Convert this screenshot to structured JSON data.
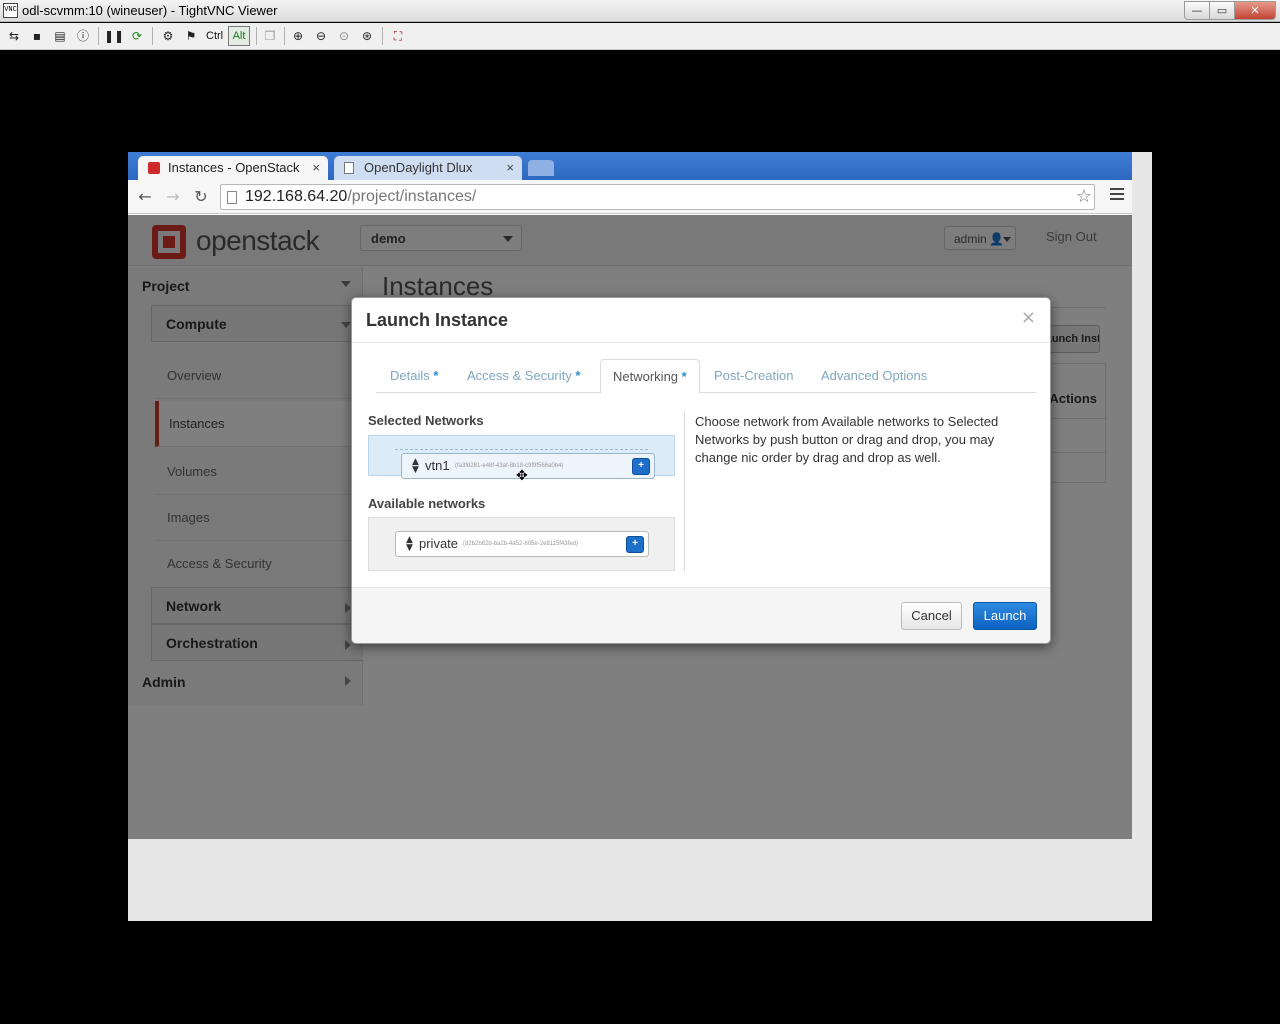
{
  "vnc": {
    "title": "odl-scvmm:10 (wineuser) - TightVNC Viewer",
    "icon_label": "VNC",
    "window_controls": {
      "minimize": "—",
      "maximize": "▭",
      "close": "✕"
    },
    "toolbar": {
      "ctrl_label": "Ctrl",
      "alt_label": "Alt"
    }
  },
  "browser": {
    "tabs": [
      {
        "label": "Instances - OpenStack",
        "close": "×",
        "active": true
      },
      {
        "label": "OpenDaylight Dlux",
        "close": "×",
        "active": false
      }
    ],
    "url_host": "192.168.64.20",
    "url_path": "/project/instances/"
  },
  "dashboard": {
    "brand": "openstack",
    "project_selector": "demo",
    "user_menu": "admin",
    "sign_out": "Sign Out",
    "sidebar": {
      "project": "Project",
      "compute": "Compute",
      "items": [
        "Overview",
        "Instances",
        "Volumes",
        "Images",
        "Access & Security"
      ],
      "network": "Network",
      "orchestration": "Orchestration",
      "admin": "Admin"
    },
    "page_title": "Instances",
    "launch_button": "Launch Instance",
    "actions_header": "Actions"
  },
  "modal": {
    "title": "Launch Instance",
    "close": "×",
    "tabs": [
      {
        "label": "Details",
        "required": "*"
      },
      {
        "label": "Access & Security",
        "required": "*"
      },
      {
        "label": "Networking",
        "required": "*"
      },
      {
        "label": "Post-Creation",
        "required": ""
      },
      {
        "label": "Advanced Options",
        "required": ""
      }
    ],
    "active_tab": "Networking",
    "selected_networks_label": "Selected Networks",
    "available_networks_label": "Available networks",
    "selected_networks": [
      {
        "name": "vtn1",
        "id": "(fa3fd281-e48f-43af-8b18-c9f9f566a0b4)",
        "button": "+"
      }
    ],
    "available_networks": [
      {
        "name": "private",
        "id": "(d2b2b82b-ba2b-4a52-805e-2e8115f43fed)",
        "button": "+"
      }
    ],
    "help_text": "Choose network from Available networks to Selected Networks by push button or drag and drop, you may change nic order by drag and drop as well.",
    "cancel": "Cancel",
    "launch": "Launch"
  },
  "colors": {
    "accent_blue": "#1d6fc9",
    "openstack_red": "#d8342a",
    "active_nav_border": "#c8412f"
  },
  "icons": {
    "vnc_toolbar": [
      "new-connection-icon",
      "save-icon",
      "options-icon",
      "info-icon",
      "pause-icon",
      "refresh-icon",
      "ctrl-alt-del-icon",
      "ctrl-esc-icon",
      "clipboard-icon",
      "zoom-in-icon",
      "zoom-out-icon",
      "zoom-100-icon",
      "zoom-fit-icon",
      "fullscreen-icon"
    ]
  }
}
